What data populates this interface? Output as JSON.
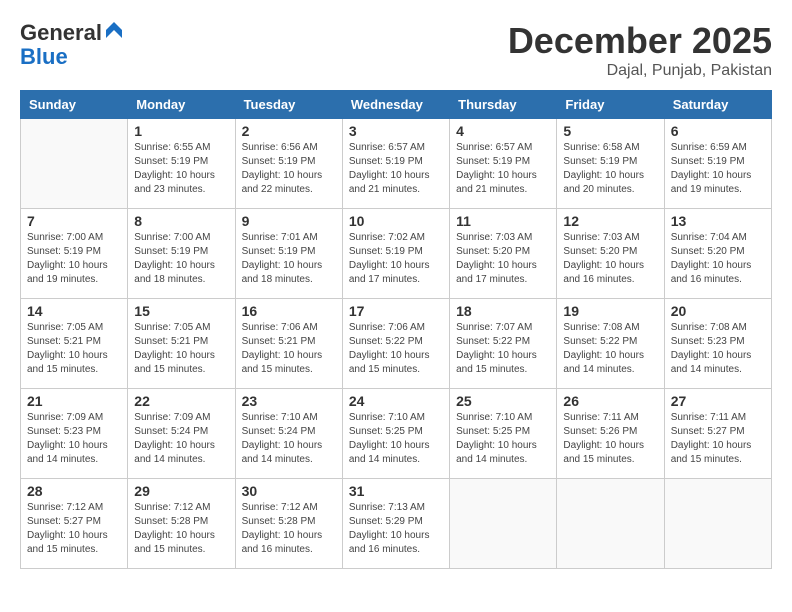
{
  "logo": {
    "general": "General",
    "blue": "Blue"
  },
  "header": {
    "month": "December 2025",
    "location": "Dajal, Punjab, Pakistan"
  },
  "weekdays": [
    "Sunday",
    "Monday",
    "Tuesday",
    "Wednesday",
    "Thursday",
    "Friday",
    "Saturday"
  ],
  "weeks": [
    [
      {
        "day": "",
        "sunrise": "",
        "sunset": "",
        "daylight": ""
      },
      {
        "day": "1",
        "sunrise": "Sunrise: 6:55 AM",
        "sunset": "Sunset: 5:19 PM",
        "daylight": "Daylight: 10 hours and 23 minutes."
      },
      {
        "day": "2",
        "sunrise": "Sunrise: 6:56 AM",
        "sunset": "Sunset: 5:19 PM",
        "daylight": "Daylight: 10 hours and 22 minutes."
      },
      {
        "day": "3",
        "sunrise": "Sunrise: 6:57 AM",
        "sunset": "Sunset: 5:19 PM",
        "daylight": "Daylight: 10 hours and 21 minutes."
      },
      {
        "day": "4",
        "sunrise": "Sunrise: 6:57 AM",
        "sunset": "Sunset: 5:19 PM",
        "daylight": "Daylight: 10 hours and 21 minutes."
      },
      {
        "day": "5",
        "sunrise": "Sunrise: 6:58 AM",
        "sunset": "Sunset: 5:19 PM",
        "daylight": "Daylight: 10 hours and 20 minutes."
      },
      {
        "day": "6",
        "sunrise": "Sunrise: 6:59 AM",
        "sunset": "Sunset: 5:19 PM",
        "daylight": "Daylight: 10 hours and 19 minutes."
      }
    ],
    [
      {
        "day": "7",
        "sunrise": "Sunrise: 7:00 AM",
        "sunset": "Sunset: 5:19 PM",
        "daylight": "Daylight: 10 hours and 19 minutes."
      },
      {
        "day": "8",
        "sunrise": "Sunrise: 7:00 AM",
        "sunset": "Sunset: 5:19 PM",
        "daylight": "Daylight: 10 hours and 18 minutes."
      },
      {
        "day": "9",
        "sunrise": "Sunrise: 7:01 AM",
        "sunset": "Sunset: 5:19 PM",
        "daylight": "Daylight: 10 hours and 18 minutes."
      },
      {
        "day": "10",
        "sunrise": "Sunrise: 7:02 AM",
        "sunset": "Sunset: 5:19 PM",
        "daylight": "Daylight: 10 hours and 17 minutes."
      },
      {
        "day": "11",
        "sunrise": "Sunrise: 7:03 AM",
        "sunset": "Sunset: 5:20 PM",
        "daylight": "Daylight: 10 hours and 17 minutes."
      },
      {
        "day": "12",
        "sunrise": "Sunrise: 7:03 AM",
        "sunset": "Sunset: 5:20 PM",
        "daylight": "Daylight: 10 hours and 16 minutes."
      },
      {
        "day": "13",
        "sunrise": "Sunrise: 7:04 AM",
        "sunset": "Sunset: 5:20 PM",
        "daylight": "Daylight: 10 hours and 16 minutes."
      }
    ],
    [
      {
        "day": "14",
        "sunrise": "Sunrise: 7:05 AM",
        "sunset": "Sunset: 5:21 PM",
        "daylight": "Daylight: 10 hours and 15 minutes."
      },
      {
        "day": "15",
        "sunrise": "Sunrise: 7:05 AM",
        "sunset": "Sunset: 5:21 PM",
        "daylight": "Daylight: 10 hours and 15 minutes."
      },
      {
        "day": "16",
        "sunrise": "Sunrise: 7:06 AM",
        "sunset": "Sunset: 5:21 PM",
        "daylight": "Daylight: 10 hours and 15 minutes."
      },
      {
        "day": "17",
        "sunrise": "Sunrise: 7:06 AM",
        "sunset": "Sunset: 5:22 PM",
        "daylight": "Daylight: 10 hours and 15 minutes."
      },
      {
        "day": "18",
        "sunrise": "Sunrise: 7:07 AM",
        "sunset": "Sunset: 5:22 PM",
        "daylight": "Daylight: 10 hours and 15 minutes."
      },
      {
        "day": "19",
        "sunrise": "Sunrise: 7:08 AM",
        "sunset": "Sunset: 5:22 PM",
        "daylight": "Daylight: 10 hours and 14 minutes."
      },
      {
        "day": "20",
        "sunrise": "Sunrise: 7:08 AM",
        "sunset": "Sunset: 5:23 PM",
        "daylight": "Daylight: 10 hours and 14 minutes."
      }
    ],
    [
      {
        "day": "21",
        "sunrise": "Sunrise: 7:09 AM",
        "sunset": "Sunset: 5:23 PM",
        "daylight": "Daylight: 10 hours and 14 minutes."
      },
      {
        "day": "22",
        "sunrise": "Sunrise: 7:09 AM",
        "sunset": "Sunset: 5:24 PM",
        "daylight": "Daylight: 10 hours and 14 minutes."
      },
      {
        "day": "23",
        "sunrise": "Sunrise: 7:10 AM",
        "sunset": "Sunset: 5:24 PM",
        "daylight": "Daylight: 10 hours and 14 minutes."
      },
      {
        "day": "24",
        "sunrise": "Sunrise: 7:10 AM",
        "sunset": "Sunset: 5:25 PM",
        "daylight": "Daylight: 10 hours and 14 minutes."
      },
      {
        "day": "25",
        "sunrise": "Sunrise: 7:10 AM",
        "sunset": "Sunset: 5:25 PM",
        "daylight": "Daylight: 10 hours and 14 minutes."
      },
      {
        "day": "26",
        "sunrise": "Sunrise: 7:11 AM",
        "sunset": "Sunset: 5:26 PM",
        "daylight": "Daylight: 10 hours and 15 minutes."
      },
      {
        "day": "27",
        "sunrise": "Sunrise: 7:11 AM",
        "sunset": "Sunset: 5:27 PM",
        "daylight": "Daylight: 10 hours and 15 minutes."
      }
    ],
    [
      {
        "day": "28",
        "sunrise": "Sunrise: 7:12 AM",
        "sunset": "Sunset: 5:27 PM",
        "daylight": "Daylight: 10 hours and 15 minutes."
      },
      {
        "day": "29",
        "sunrise": "Sunrise: 7:12 AM",
        "sunset": "Sunset: 5:28 PM",
        "daylight": "Daylight: 10 hours and 15 minutes."
      },
      {
        "day": "30",
        "sunrise": "Sunrise: 7:12 AM",
        "sunset": "Sunset: 5:28 PM",
        "daylight": "Daylight: 10 hours and 16 minutes."
      },
      {
        "day": "31",
        "sunrise": "Sunrise: 7:13 AM",
        "sunset": "Sunset: 5:29 PM",
        "daylight": "Daylight: 10 hours and 16 minutes."
      },
      {
        "day": "",
        "sunrise": "",
        "sunset": "",
        "daylight": ""
      },
      {
        "day": "",
        "sunrise": "",
        "sunset": "",
        "daylight": ""
      },
      {
        "day": "",
        "sunrise": "",
        "sunset": "",
        "daylight": ""
      }
    ]
  ]
}
